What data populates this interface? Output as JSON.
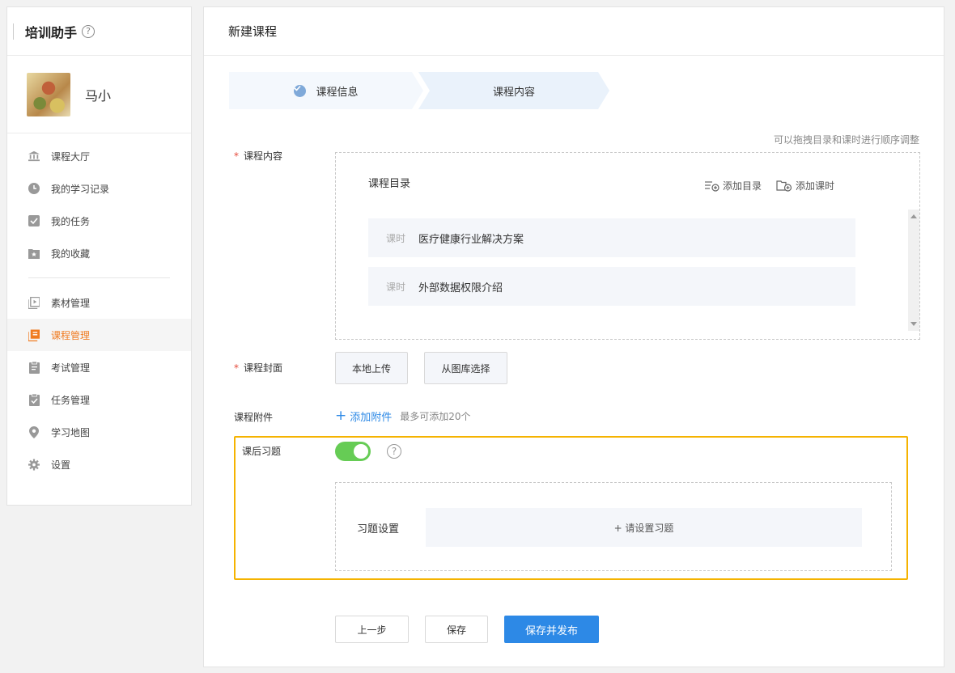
{
  "sidebar": {
    "title": "培训助手",
    "help_glyph": "?",
    "user": {
      "name": "马小"
    },
    "items": [
      {
        "label": "课程大厅",
        "icon": "bank-icon"
      },
      {
        "label": "我的学习记录",
        "icon": "clock-icon"
      },
      {
        "label": "我的任务",
        "icon": "check-square-icon"
      },
      {
        "label": "我的收藏",
        "icon": "star-folder-icon"
      },
      {
        "label": "素材管理",
        "icon": "video-icon"
      },
      {
        "label": "课程管理",
        "icon": "course-icon",
        "active": true
      },
      {
        "label": "考试管理",
        "icon": "exam-clipboard-icon"
      },
      {
        "label": "任务管理",
        "icon": "task-clipboard-icon"
      },
      {
        "label": "学习地图",
        "icon": "map-pin-icon"
      },
      {
        "label": "设置",
        "icon": "gear-icon"
      }
    ]
  },
  "header": {
    "title": "新建课程"
  },
  "steps": [
    {
      "label": "课程信息",
      "done": true
    },
    {
      "label": "课程内容",
      "done": false
    }
  ],
  "form": {
    "hint": "可以拖拽目录和课时进行顺序调整",
    "content_label": "课程内容",
    "directory_title": "课程目录",
    "add_directory": "添加目录",
    "add_lesson": "添加课时",
    "lessons": [
      {
        "tag": "课时",
        "title": "医疗健康行业解决方案"
      },
      {
        "tag": "课时",
        "title": "外部数据权限介绍"
      }
    ],
    "cover_label": "课程封面",
    "upload_local": "本地上传",
    "choose_gallery": "从图库选择",
    "attachment_label": "课程附件",
    "add_attachment": "添加附件",
    "attachment_limit": "最多可添加20个",
    "exercise_label": "课后习题",
    "exercise_enabled": true,
    "exercise_help": "?",
    "exercise_setting_label": "习题设置",
    "exercise_setting_button": "+ 请设置习题"
  },
  "footer": {
    "prev": "上一步",
    "save": "保存",
    "save_publish": "保存并发布"
  },
  "colors": {
    "accent": "#f07b21",
    "primary": "#2d89e6",
    "toggle_on": "#66cc55",
    "highlight": "#f5b300"
  }
}
